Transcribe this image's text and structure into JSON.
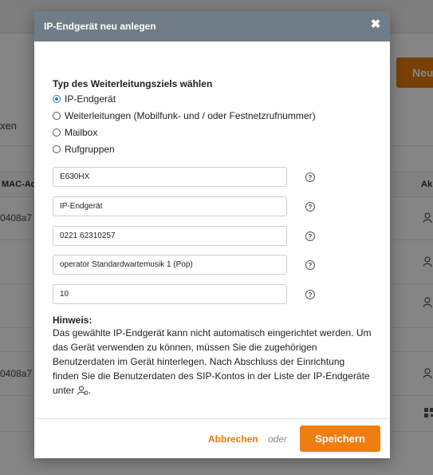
{
  "background": {
    "new_button_label": "Neu",
    "tab_label": "xen",
    "col_mac_label": "MAC-Adr",
    "col_actions_label": "Ak",
    "row1_mac": "0408a7",
    "row2_mac": "0408a7"
  },
  "dialog": {
    "title": "IP-Endgerät neu anlegen",
    "close_icon": "close-icon",
    "section_title": "Typ des Weiterleitungsziels wählen",
    "options": [
      {
        "label": "IP-Endgerät",
        "selected": true
      },
      {
        "label": "Weiterleitungen (Mobilfunk- und / oder Festnetzrufnummer)",
        "selected": false
      },
      {
        "label": "Mailbox",
        "selected": false
      },
      {
        "label": "Rufgruppen",
        "selected": false
      }
    ],
    "fields": [
      {
        "value": "E630HX"
      },
      {
        "value": "IP-Endgerät"
      },
      {
        "value": "0221 62310257"
      },
      {
        "value": "operator Standardwartemusik 1 (Pop)"
      },
      {
        "value": "10"
      }
    ],
    "help_icon_label": "?",
    "hint_title": "Hinweis:",
    "hint_text": "Das gewählte IP-Endgerät kann nicht automatisch eingerichtet werden. Um das Gerät verwenden zu können, müssen Sie die zugehörigen Benutzerdaten im Gerät hinterlegen. Nach Abschluss der Einrichtung finden Sie die Benutzerdaten des SIP-Kontos in der Liste der IP-Endgeräte unter",
    "hint_end": ".",
    "cancel_label": "Abbrechen",
    "or_label": "oder",
    "save_label": "Speichern"
  },
  "colors": {
    "accent_orange": "#f07d10",
    "header_gray": "#717d86",
    "radio_blue": "#2f7dc7"
  }
}
